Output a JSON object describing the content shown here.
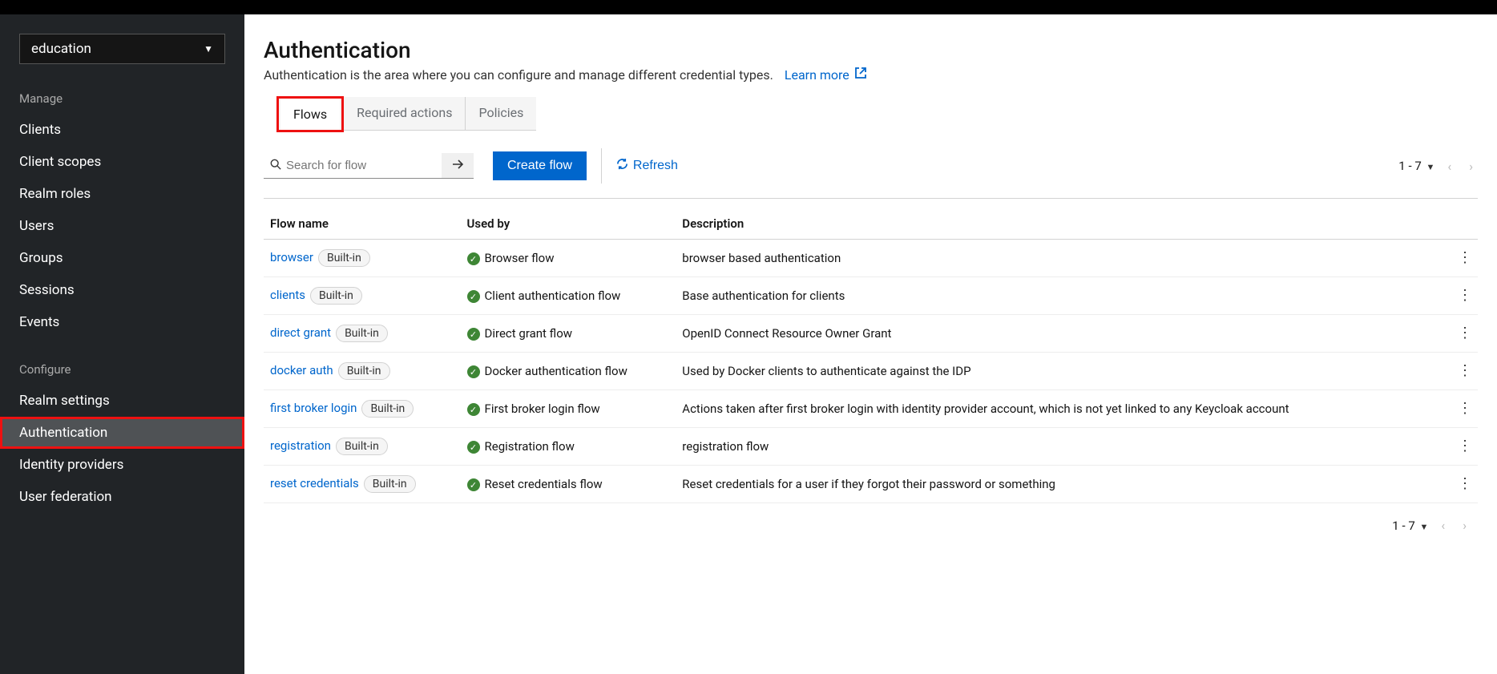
{
  "realm": {
    "selected": "education"
  },
  "sidebar": {
    "group_manage": "Manage",
    "group_configure": "Configure",
    "items_manage": [
      {
        "label": "Clients"
      },
      {
        "label": "Client scopes"
      },
      {
        "label": "Realm roles"
      },
      {
        "label": "Users"
      },
      {
        "label": "Groups"
      },
      {
        "label": "Sessions"
      },
      {
        "label": "Events"
      }
    ],
    "items_configure": [
      {
        "label": "Realm settings"
      },
      {
        "label": "Authentication",
        "active": true
      },
      {
        "label": "Identity providers"
      },
      {
        "label": "User federation"
      }
    ]
  },
  "page": {
    "title": "Authentication",
    "description": "Authentication is the area where you can configure and manage different credential types.",
    "learn_more": "Learn more"
  },
  "tabs": [
    {
      "label": "Flows",
      "active": true
    },
    {
      "label": "Required actions"
    },
    {
      "label": "Policies"
    }
  ],
  "toolbar": {
    "search_placeholder": "Search for flow",
    "create_label": "Create flow",
    "refresh_label": "Refresh",
    "page_range": "1 - 7"
  },
  "table": {
    "headers": {
      "name": "Flow name",
      "usedby": "Used by",
      "desc": "Description"
    },
    "badge_label": "Built-in",
    "rows": [
      {
        "name": "browser",
        "usedby": "Browser flow",
        "desc": "browser based authentication"
      },
      {
        "name": "clients",
        "usedby": "Client authentication flow",
        "desc": "Base authentication for clients"
      },
      {
        "name": "direct grant",
        "usedby": "Direct grant flow",
        "desc": "OpenID Connect Resource Owner Grant"
      },
      {
        "name": "docker auth",
        "usedby": "Docker authentication flow",
        "desc": "Used by Docker clients to authenticate against the IDP"
      },
      {
        "name": "first broker login",
        "usedby": "First broker login flow",
        "desc": "Actions taken after first broker login with identity provider account, which is not yet linked to any Keycloak account"
      },
      {
        "name": "registration",
        "usedby": "Registration flow",
        "desc": "registration flow"
      },
      {
        "name": "reset credentials",
        "usedby": "Reset credentials flow",
        "desc": "Reset credentials for a user if they forgot their password or something"
      }
    ]
  }
}
